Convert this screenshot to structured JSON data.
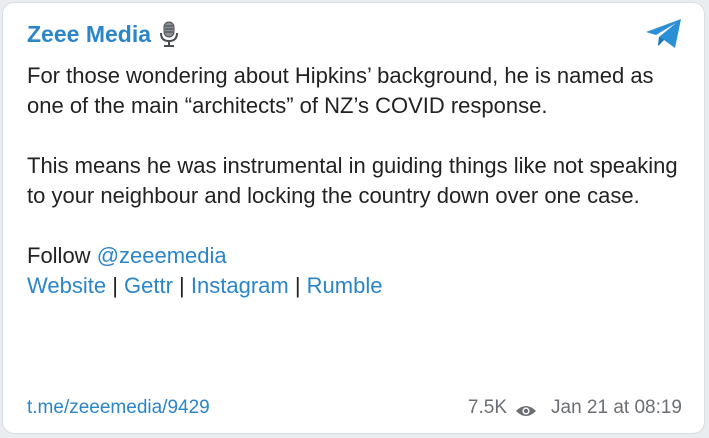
{
  "channel": {
    "name": "Zeee Media",
    "accent_color": "#2b85c9"
  },
  "message": {
    "paragraph1": "For those wondering about Hipkins’ background, he is named as one of the main “architects” of NZ’s COVID response.",
    "paragraph2": "This means he was instrumental in guiding things like not speaking to your neighbour and locking the country down over one case.",
    "follow_prefix": "Follow ",
    "follow_handle": "@zeeemedia",
    "links": [
      {
        "label": "Website"
      },
      {
        "label": "Gettr"
      },
      {
        "label": "Instagram"
      },
      {
        "label": "Rumble"
      }
    ],
    "separator": " | "
  },
  "footer": {
    "post_link": "t.me/zeeemedia/9429",
    "views": "7.5K",
    "timestamp": "Jan 21 at 08:19"
  },
  "icons": {
    "header": "microphone-icon",
    "share": "telegram-plane-icon",
    "views": "eye-icon"
  }
}
